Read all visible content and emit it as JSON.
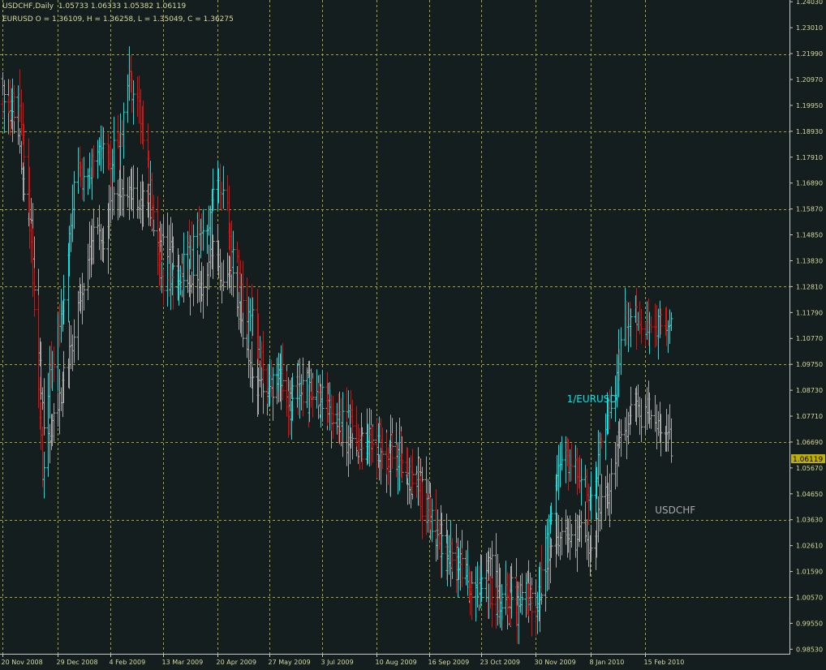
{
  "chart_data": {
    "type": "bar",
    "title": "USDCHF,Daily  1.05733 1.06333 1.05382 1.06119",
    "subtitle": "EURUSD O = 1.36109, H = 1.36258, L = 1.35049, C = 1.36275",
    "current_price_label": "1.06119",
    "current_price": 1.06119,
    "ylim": [
      0.9835,
      1.241
    ],
    "y_ticks": [
      "1.24030",
      "1.23010",
      "1.21990",
      "1.20970",
      "1.19950",
      "1.18930",
      "1.17910",
      "1.16890",
      "1.15870",
      "1.14850",
      "1.13830",
      "1.12810",
      "1.11790",
      "1.10770",
      "1.09750",
      "1.08730",
      "1.07710",
      "1.06690",
      "1.05670",
      "1.04650",
      "1.03630",
      "1.02610",
      "1.01590",
      "1.00570",
      "0.99550",
      "0.98530"
    ],
    "y_grid_lines": [
      1.2197,
      1.1893,
      1.1587,
      1.1281,
      1.0975,
      1.0669,
      1.0363,
      1.0059
    ],
    "x_ticks": [
      "20 Nov 2008",
      "29 Dec 2008",
      "4 Feb 2009",
      "13 Mar 2009",
      "20 Apr 2009",
      "27 May 2009",
      "3 Jul 2009",
      "10 Aug 2009",
      "16 Sep 2009",
      "23 Oct 2009",
      "30 Nov 2009",
      "8 Jan 2010",
      "15 Feb 2010"
    ],
    "grid": true,
    "series": [
      {
        "name": "1/EURUSD",
        "up_color": "#00e8e8",
        "down_color": "#e01010",
        "anchors": [
          [
            "20 Nov 2008",
            1.2
          ],
          [
            "1 Dec 2008",
            1.192
          ],
          [
            "8 Dec 2008",
            1.17
          ],
          [
            "18 Dec 2008",
            1.05
          ],
          [
            "23 Dec 2008",
            1.09
          ],
          [
            "29 Dec 2008",
            1.11
          ],
          [
            "10 Jan 2009",
            1.17
          ],
          [
            "20 Jan 2009",
            1.18
          ],
          [
            "4 Feb 2009",
            1.185
          ],
          [
            "18 Feb 2009",
            1.205
          ],
          [
            "1 Mar 2009",
            1.185
          ],
          [
            "13 Mar 2009",
            1.125
          ],
          [
            "25 Mar 2009",
            1.14
          ],
          [
            "5 Apr 2009",
            1.15
          ],
          [
            "20 Apr 2009",
            1.165
          ],
          [
            "1 May 2009",
            1.14
          ],
          [
            "12 May 2009",
            1.12
          ],
          [
            "27 May 2009",
            1.09
          ],
          [
            "10 Jun 2009",
            1.08
          ],
          [
            "3 Jul 2009",
            1.085
          ],
          [
            "20 Jul 2009",
            1.07
          ],
          [
            "10 Aug 2009",
            1.07
          ],
          [
            "25 Aug 2009",
            1.065
          ],
          [
            "5 Sep 2009",
            1.06
          ],
          [
            "16 Sep 2009",
            1.04
          ],
          [
            "5 Oct 2009",
            1.02
          ],
          [
            "23 Oct 2009",
            1.005
          ],
          [
            "10 Nov 2009",
            1.005
          ],
          [
            "30 Nov 2009",
            0.996
          ],
          [
            "10 Dec 2009",
            1.03
          ],
          [
            "20 Dec 2009",
            1.06
          ],
          [
            "8 Jan 2010",
            1.048
          ],
          [
            "20 Jan 2010",
            1.08
          ],
          [
            "1 Feb 2010",
            1.112
          ],
          [
            "15 Feb 2010",
            1.118
          ],
          [
            "25 Feb 2010",
            1.12
          ],
          [
            "5 Mar 2010",
            1.12
          ]
        ]
      },
      {
        "name": "USDCHF",
        "color": "#a8a8a8",
        "anchors": [
          [
            "20 Nov 2008",
            1.21
          ],
          [
            "1 Dec 2008",
            1.195
          ],
          [
            "10 Dec 2008",
            1.15
          ],
          [
            "20 Dec 2008",
            1.06
          ],
          [
            "29 Dec 2008",
            1.08
          ],
          [
            "10 Jan 2009",
            1.11
          ],
          [
            "20 Jan 2009",
            1.14
          ],
          [
            "4 Feb 2009",
            1.16
          ],
          [
            "20 Feb 2009",
            1.17
          ],
          [
            "1 Mar 2009",
            1.16
          ],
          [
            "13 Mar 2009",
            1.14
          ],
          [
            "25 Mar 2009",
            1.13
          ],
          [
            "5 Apr 2009",
            1.13
          ],
          [
            "20 Apr 2009",
            1.14
          ],
          [
            "1 May 2009",
            1.13
          ],
          [
            "12 May 2009",
            1.1
          ],
          [
            "27 May 2009",
            1.08
          ],
          [
            "10 Jun 2009",
            1.082
          ],
          [
            "3 Jul 2009",
            1.085
          ],
          [
            "20 Jul 2009",
            1.065
          ],
          [
            "10 Aug 2009",
            1.065
          ],
          [
            "25 Aug 2009",
            1.06
          ],
          [
            "5 Sep 2009",
            1.055
          ],
          [
            "16 Sep 2009",
            1.035
          ],
          [
            "5 Oct 2009",
            1.02
          ],
          [
            "23 Oct 2009",
            1.01
          ],
          [
            "10 Nov 2009",
            1.006
          ],
          [
            "30 Nov 2009",
            1.003
          ],
          [
            "10 Dec 2009",
            1.035
          ],
          [
            "20 Dec 2009",
            1.03
          ],
          [
            "8 Jan 2010",
            1.025
          ],
          [
            "20 Jan 2010",
            1.045
          ],
          [
            "1 Feb 2010",
            1.07
          ],
          [
            "15 Feb 2010",
            1.078
          ],
          [
            "25 Feb 2010",
            1.075
          ],
          [
            "5 Mar 2010",
            1.058
          ]
        ]
      }
    ],
    "annotations": [
      {
        "text": "1/EURUSD",
        "x": "22 Dec 2009",
        "y": 1.0825,
        "color": "#00e8e8"
      },
      {
        "text": "USDCHF",
        "x": "22 Feb 2010",
        "y": 1.0387,
        "color": "#a8a8a8"
      }
    ]
  },
  "colors": {
    "background": "#141e1e",
    "grid": "#a6a236",
    "axis": "#c8c8c8",
    "text": "#d8d8a0",
    "price_tag": "#c0b000"
  }
}
